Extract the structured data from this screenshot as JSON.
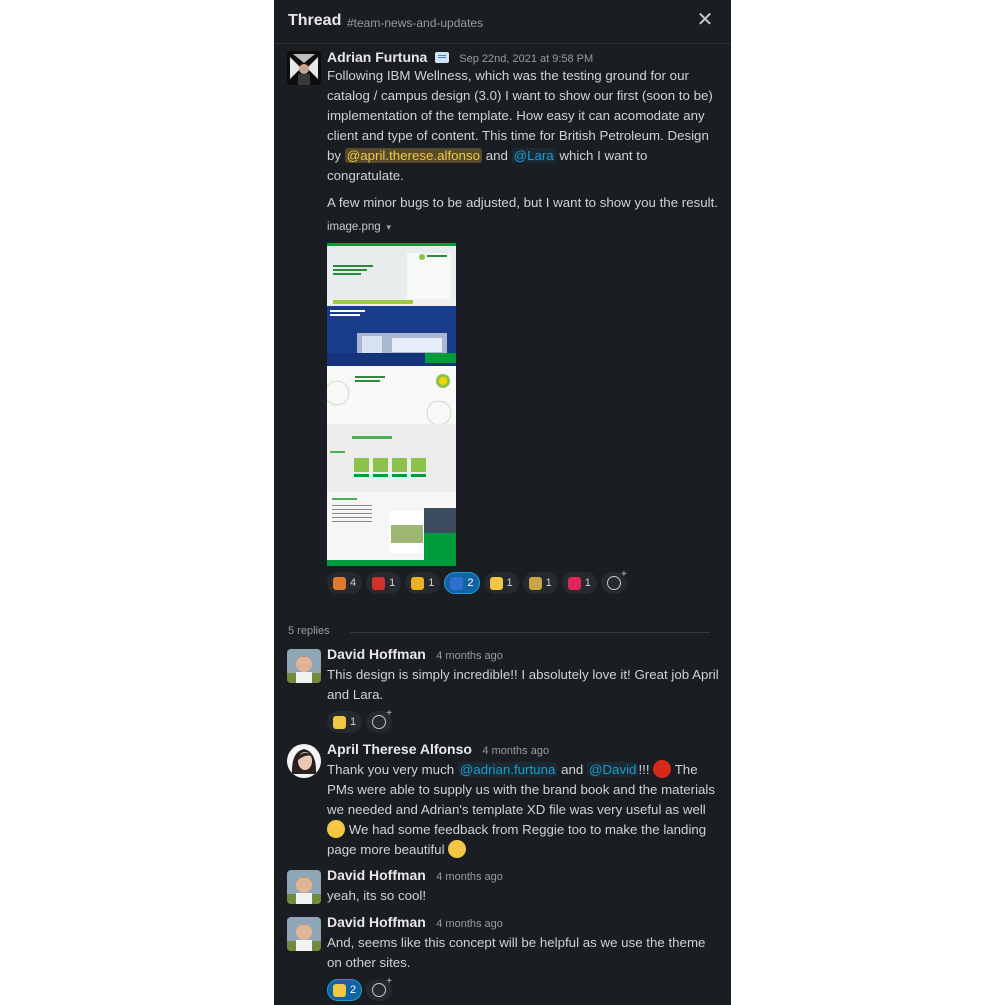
{
  "header": {
    "title": "Thread",
    "channel": "#team-news-and-updates"
  },
  "messages": [
    {
      "author": "Adrian Furtuna",
      "time": "Sep 22nd, 2021 at 9:58 PM",
      "p1_a": "Following IBM Wellness, which was the testing ground for our catalog / campus design (3.0) I want to show our first (soon to be) implementation of the template. How easy it can acomodate any client and type of content. This time for British Petroleum. Design by ",
      "mention1": "@april.therese.alfonso",
      "p1_b": " and ",
      "mention2": "@Lara",
      "p1_c": " which I want to congratulate.",
      "p2": "A few minor bugs to be adjusted, but I want to show you the result.",
      "file_name": "image.png",
      "reactions": [
        {
          "emoji": "party-icon",
          "count": "4",
          "color": "#e07a2e"
        },
        {
          "emoji": "flag-icon",
          "count": "1",
          "color": "#d33030"
        },
        {
          "emoji": "trophy-icon",
          "count": "1",
          "color": "#e5b323"
        },
        {
          "emoji": "yes-icon",
          "count": "2",
          "color": "#2f6fd0",
          "active": true
        },
        {
          "emoji": "worried-face-icon",
          "count": "1",
          "color": "#f2c744"
        },
        {
          "emoji": "fy-icon",
          "count": "1",
          "color": "#c9a54a"
        },
        {
          "emoji": "heart-icon",
          "count": "1",
          "color": "#e0245e"
        }
      ]
    },
    {
      "author": "David Hoffman",
      "time": "4 months ago",
      "text": "This design is simply incredible!!  I absolutely love it!  Great job April and Lara.",
      "reactions": [
        {
          "emoji": "slight-smile-icon",
          "count": "1",
          "color": "#f2c744"
        }
      ]
    },
    {
      "author": "April Therese Alfonso",
      "time": "4 months ago",
      "t_a": "Thank you very much ",
      "mention1": "@adrian.furtuna",
      "t_b": " and ",
      "mention2": "@David",
      "t_c": "!!! ",
      "t_d": " The PMs were able to supply us with the brand book and the materials we needed and Adrian's template XD file was very useful as well ",
      "t_e": " We had some feedback from Reggie too to make the landing page more beautiful "
    },
    {
      "author": "David Hoffman",
      "time": "4 months ago",
      "text": "yeah, its so cool!"
    },
    {
      "author": "David Hoffman",
      "time": "4 months ago",
      "text": "And, seems like this concept will be helpful as we use the theme on other sites.",
      "reactions": [
        {
          "emoji": "thumbs-up-icon",
          "count": "2",
          "color": "#f2c744",
          "active": true
        }
      ]
    }
  ],
  "replies_label": "5 replies",
  "colors": {
    "panel_bg": "#1a1d21",
    "mention": "#1d9bd1",
    "mention_self": "#f2c744",
    "bp_green": "#009b3a"
  }
}
